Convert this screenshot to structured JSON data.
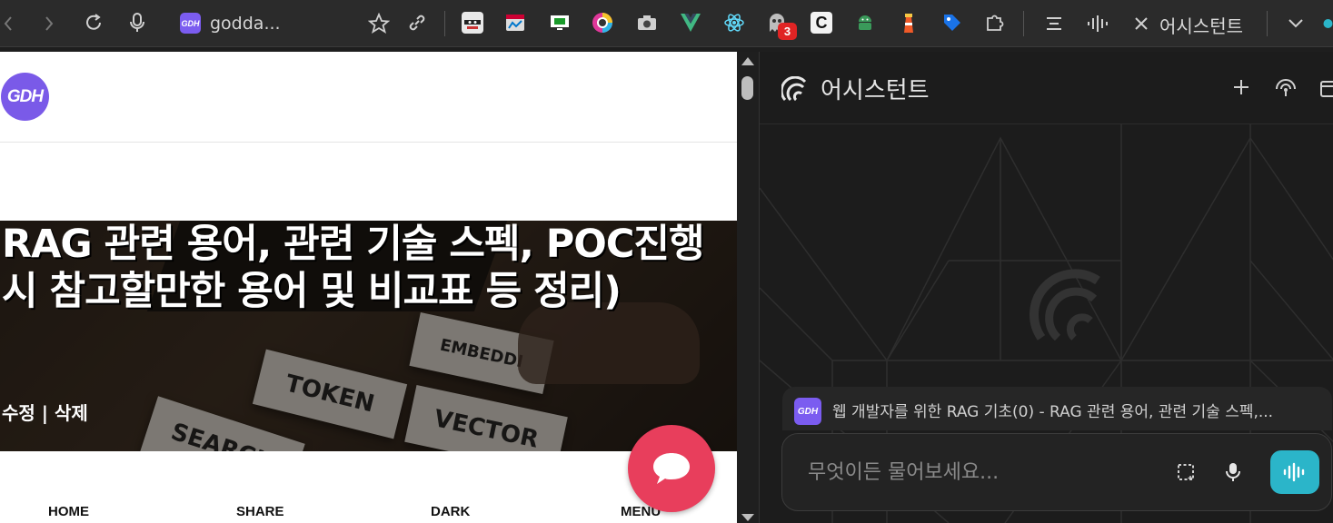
{
  "browser": {
    "tab_title": "godda...",
    "tab_favicon_text": "GDH",
    "badge_count": "3",
    "side_panel_title": "어시스턴트",
    "extensions": [
      "ninja-icon",
      "browser-icon",
      "monitor-icon",
      "color-wheel-icon",
      "camera-icon",
      "vue-icon",
      "react-icon",
      "ghost-icon",
      "c-icon",
      "android-icon",
      "lighthouse-icon",
      "tag-icon",
      "puzzle-icon"
    ]
  },
  "page": {
    "logo_text": "GDH",
    "hero_title": "RAG 관련 용어, 관련 기술 스펙, POC진행시 참고할만한 용어 및 비교표 등 정리)",
    "actions": "수정 | 삭제",
    "hero_words": [
      "EMBEDDI",
      "TOKEN",
      "VECTOR",
      "SEARCH"
    ],
    "nav": [
      "HOME",
      "SHARE",
      "DARK",
      "MENU"
    ]
  },
  "assistant": {
    "title": "어시스턴트",
    "context_favicon": "GDH",
    "context_text": "웹 개발자를 위한 RAG 기초(0) - RAG 관련 용어, 관련 기술 스펙,...",
    "input_placeholder": "무엇이든 물어보세요..."
  },
  "colors": {
    "accent_purple": "#7b5cf0",
    "fab_red": "#e83e5c",
    "voice_teal": "#2bb5c9"
  }
}
